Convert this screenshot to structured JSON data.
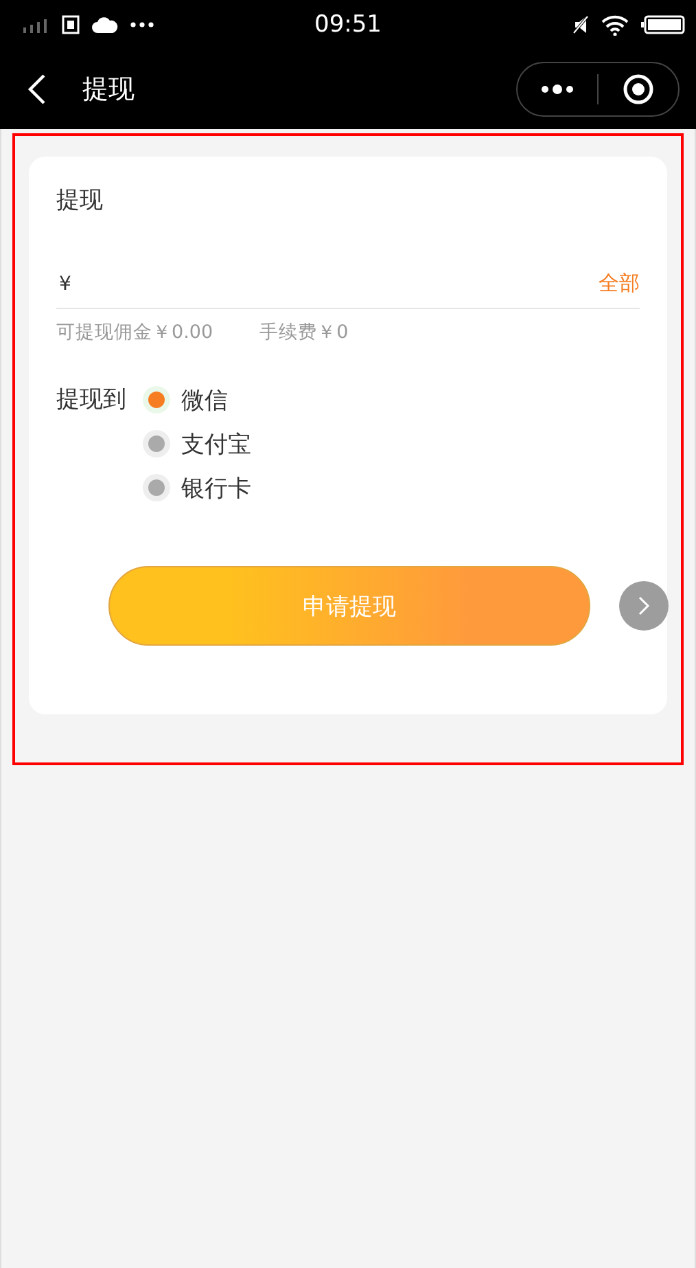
{
  "status_bar": {
    "time": "09:51"
  },
  "nav": {
    "title": "提现"
  },
  "form": {
    "title": "提现",
    "currency": "¥",
    "all_link": "全部",
    "available": "可提现佣金￥0.00",
    "fee": "手续费￥0",
    "target_label": "提现到",
    "options": [
      {
        "label": "微信",
        "selected": true
      },
      {
        "label": "支付宝",
        "selected": false
      },
      {
        "label": "银行卡",
        "selected": false
      }
    ],
    "submit": "申请提现"
  }
}
